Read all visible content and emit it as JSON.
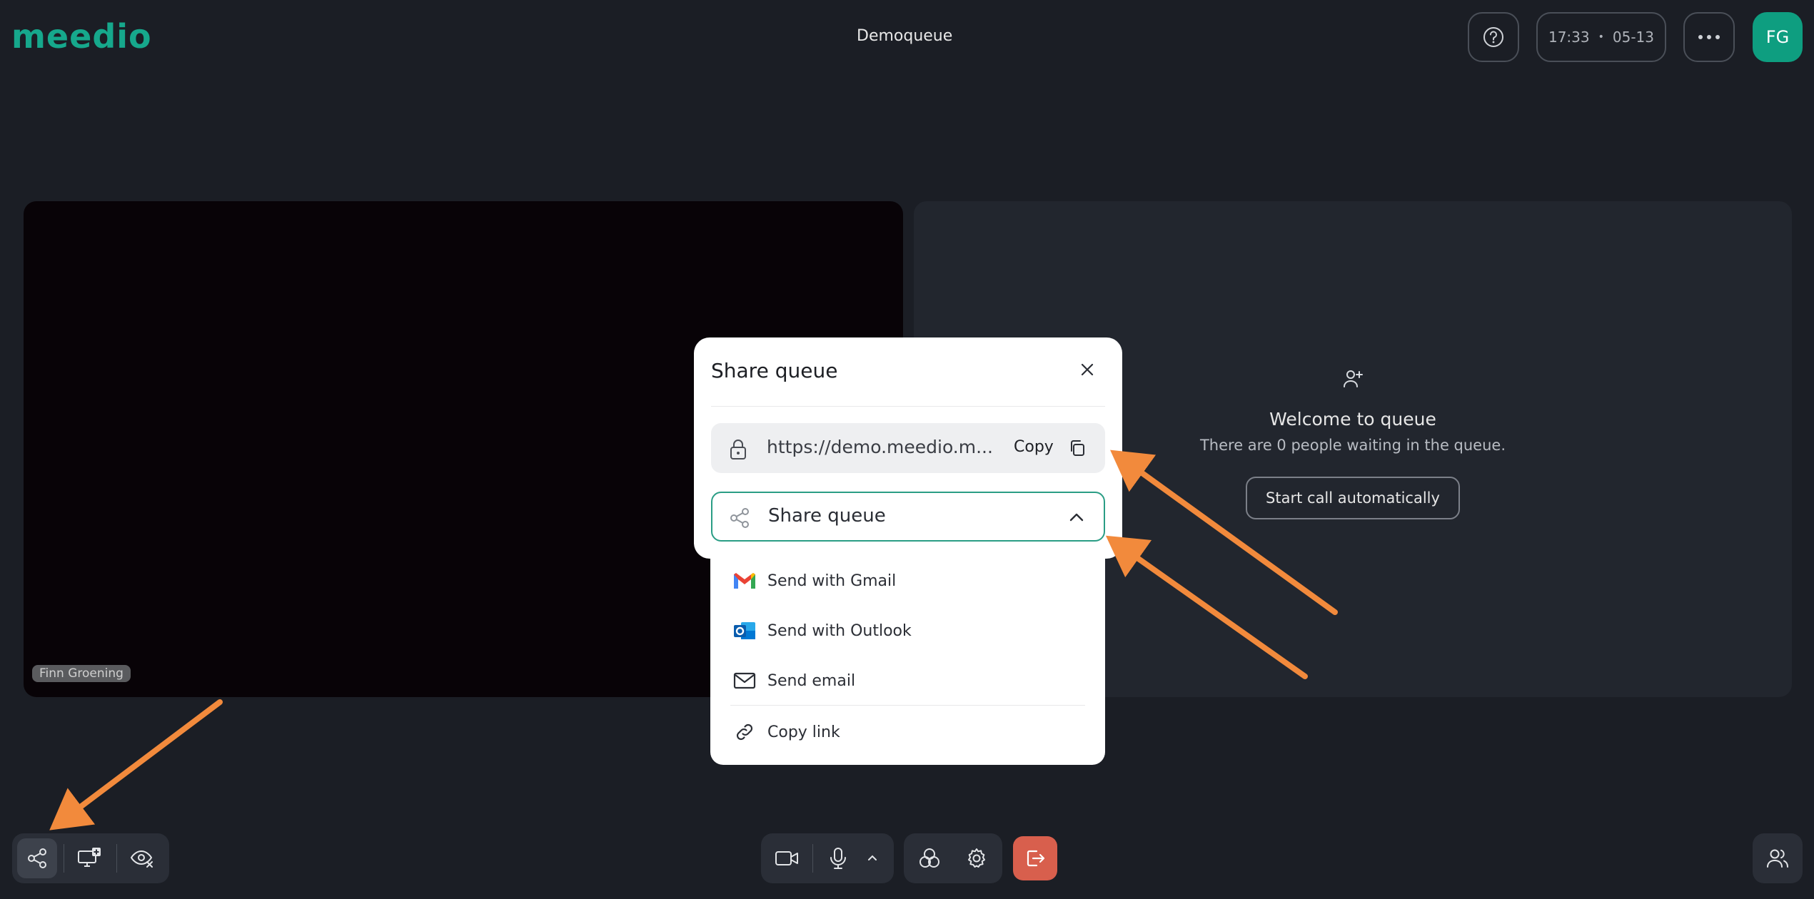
{
  "app": {
    "logo": "meedio",
    "title": "Demoqueue"
  },
  "header": {
    "time": "17:33",
    "separator": "•",
    "date": "05-13",
    "avatar_initials": "FG"
  },
  "video": {
    "participant_name": "Finn Groening"
  },
  "queue_panel": {
    "welcome_title": "Welcome to queue",
    "waiting_text": "There are 0 people waiting in the queue.",
    "start_button": "Start call automatically"
  },
  "modal": {
    "title": "Share queue",
    "url": "https://demo.meedio.m...",
    "copy_label": "Copy",
    "share_select_label": "Share queue",
    "options": [
      {
        "label": "Send with Gmail",
        "icon": "gmail-icon"
      },
      {
        "label": "Send with Outlook",
        "icon": "outlook-icon"
      },
      {
        "label": "Send email",
        "icon": "mail-icon"
      },
      {
        "label": "Copy link",
        "icon": "link-icon"
      }
    ]
  },
  "colors": {
    "brand": "#16a88c",
    "avatar": "#0e9e80",
    "leave": "#d85f4d",
    "annotation": "#f28a3c"
  }
}
